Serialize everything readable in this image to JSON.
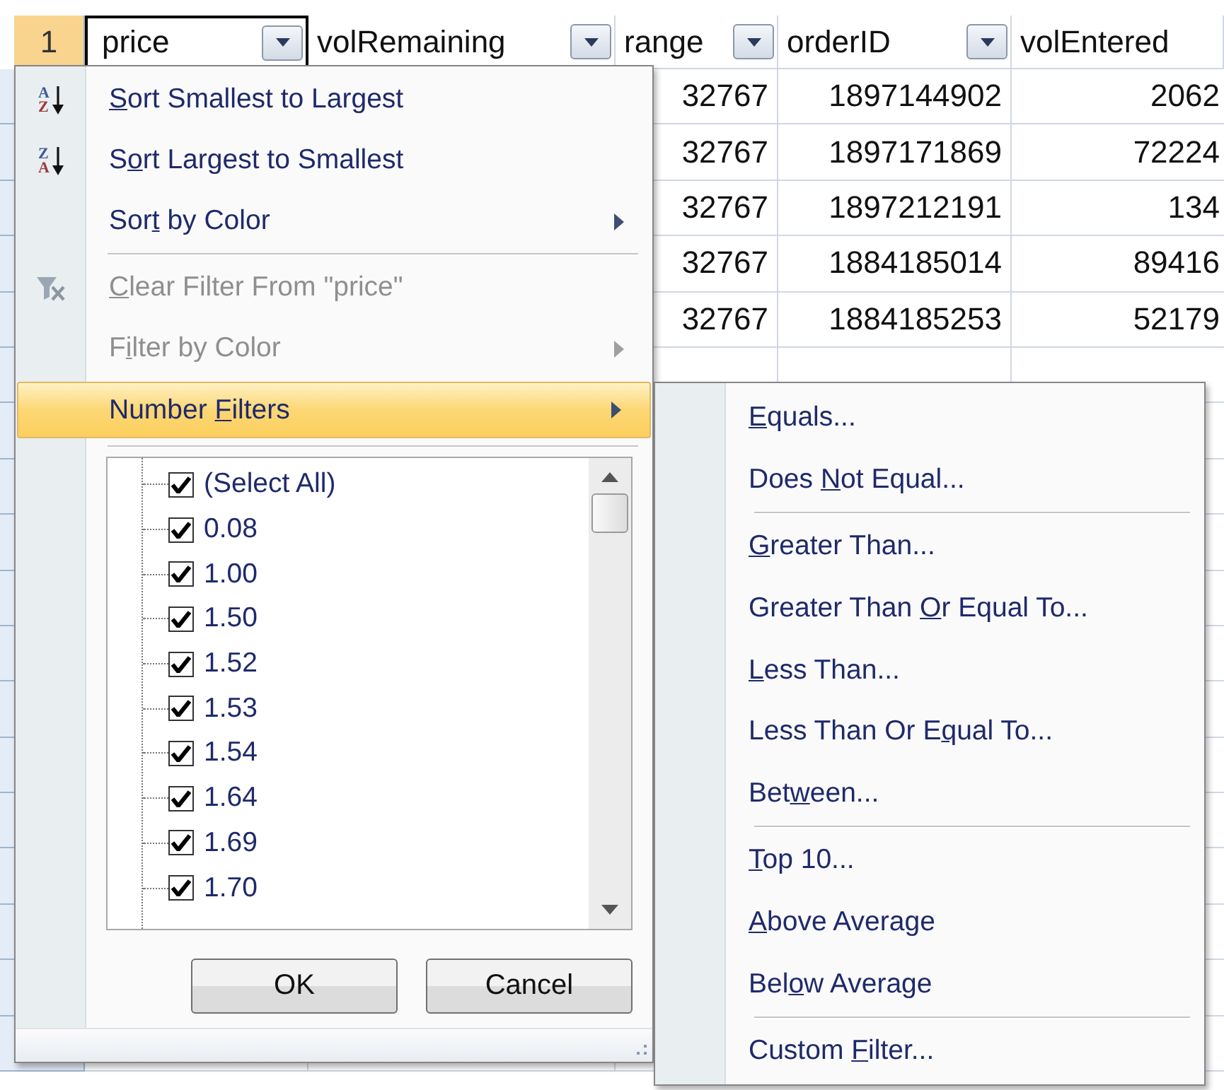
{
  "sheet": {
    "row_header": "1",
    "columns": [
      {
        "label": "price",
        "filter_button": true,
        "selected": true
      },
      {
        "label": "volRemaining",
        "filter_button": true,
        "selected": false
      },
      {
        "label": "range",
        "filter_button": true,
        "selected": false
      },
      {
        "label": "orderID",
        "filter_button": true,
        "selected": false
      },
      {
        "label": "volEntered",
        "filter_button": false,
        "selected": false
      }
    ],
    "rows": [
      {
        "cells": [
          "32767",
          "1897144902",
          "2062"
        ]
      },
      {
        "cells": [
          "32767",
          "1897171869",
          "72224"
        ]
      },
      {
        "cells": [
          "32767",
          "1897212191",
          "134"
        ]
      },
      {
        "cells": [
          "32767",
          "1884185014",
          "89416"
        ]
      },
      {
        "cells": [
          "32767",
          "1884185253",
          "52179"
        ]
      }
    ]
  },
  "filter_menu": {
    "items": [
      {
        "kind": "sort-ascending",
        "icon_letters": [
          "A",
          "Z"
        ],
        "access_key": "S",
        "label_end": "ort Smallest to Largest",
        "submenu": false,
        "disabled": false,
        "selected": false
      },
      {
        "kind": "sort-descending",
        "icon_letters": [
          "Z",
          "A"
        ],
        "label_start": "S",
        "access_key": "o",
        "label_end": "rt Largest to Smallest",
        "submenu": false,
        "disabled": false,
        "selected": false
      },
      {
        "kind": "plain",
        "label_start": "Sor",
        "access_key": "t",
        "label_end": " by Color",
        "submenu": true,
        "disabled": false,
        "selected": false
      },
      {
        "kind": "separator"
      },
      {
        "kind": "clear-filter",
        "access_key": "C",
        "label_end": "lear Filter From \"price\"",
        "submenu": false,
        "disabled": true,
        "selected": false
      },
      {
        "kind": "plain",
        "label_start": "F",
        "access_key": "i",
        "label_end": "lter by Color",
        "submenu": true,
        "disabled": true,
        "selected": false
      },
      {
        "kind": "plain",
        "label_start": "Number ",
        "access_key": "F",
        "label_end": "ilters",
        "submenu": true,
        "disabled": false,
        "selected": true
      }
    ],
    "values": [
      {
        "label": "(Select All)",
        "checked": true
      },
      {
        "label": "0.08",
        "checked": true
      },
      {
        "label": "1.00",
        "checked": true
      },
      {
        "label": "1.50",
        "checked": true
      },
      {
        "label": "1.52",
        "checked": true
      },
      {
        "label": "1.53",
        "checked": true
      },
      {
        "label": "1.54",
        "checked": true
      },
      {
        "label": "1.64",
        "checked": true
      },
      {
        "label": "1.69",
        "checked": true
      },
      {
        "label": "1.70",
        "checked": true
      }
    ],
    "buttons": [
      "OK",
      "Cancel"
    ]
  },
  "number_filters_menu": {
    "items": [
      {
        "kind": "plain",
        "access_key": "E",
        "label_end": "quals..."
      },
      {
        "kind": "plain",
        "label_start": "Does ",
        "access_key": "N",
        "label_end": "ot Equal..."
      },
      {
        "kind": "separator"
      },
      {
        "kind": "plain",
        "access_key": "G",
        "label_end": "reater Than..."
      },
      {
        "kind": "plain",
        "label_start": "Greater Than ",
        "access_key": "O",
        "label_end": "r Equal To..."
      },
      {
        "kind": "plain",
        "access_key": "L",
        "label_end": "ess Than..."
      },
      {
        "kind": "plain",
        "label_start": "Less Than Or E",
        "access_key": "q",
        "label_end": "ual To..."
      },
      {
        "kind": "plain",
        "label_start": "Bet",
        "access_key": "w",
        "label_end": "een..."
      },
      {
        "kind": "separator"
      },
      {
        "kind": "plain",
        "access_key": "T",
        "label_end": "op 10..."
      },
      {
        "kind": "plain",
        "access_key": "A",
        "label_end": "bove Average"
      },
      {
        "kind": "plain",
        "label_start": "Bel",
        "access_key": "o",
        "label_end": "w Average"
      },
      {
        "kind": "separator"
      },
      {
        "kind": "plain",
        "label_start": "Custom ",
        "access_key": "F",
        "label_end": "ilter..."
      }
    ]
  }
}
